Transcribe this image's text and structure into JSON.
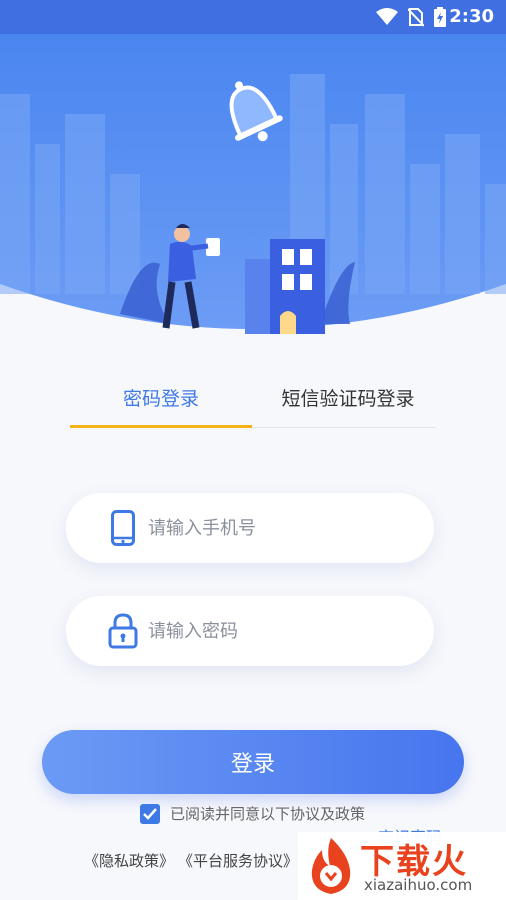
{
  "status_bar": {
    "time": "2:30"
  },
  "tabs": {
    "password_login": "密码登录",
    "sms_login": "短信验证码登录"
  },
  "phone_field": {
    "placeholder": "请输入手机号"
  },
  "password_field": {
    "placeholder": "请输入密码"
  },
  "login_button": "登录",
  "agreement": {
    "checked": true,
    "text": "已阅读并同意以下协议及政策"
  },
  "policies": {
    "privacy": "《隐私政策》",
    "service": "《平台服务协议》"
  },
  "forgot_password": "忘记密码",
  "watermark": {
    "title": "下载火",
    "site": "xiazaihuo.com"
  },
  "colors": {
    "brand_blue": "#3e79e6",
    "tab_underline": "#f5b31a",
    "header_blue": "#3f6fe0"
  }
}
